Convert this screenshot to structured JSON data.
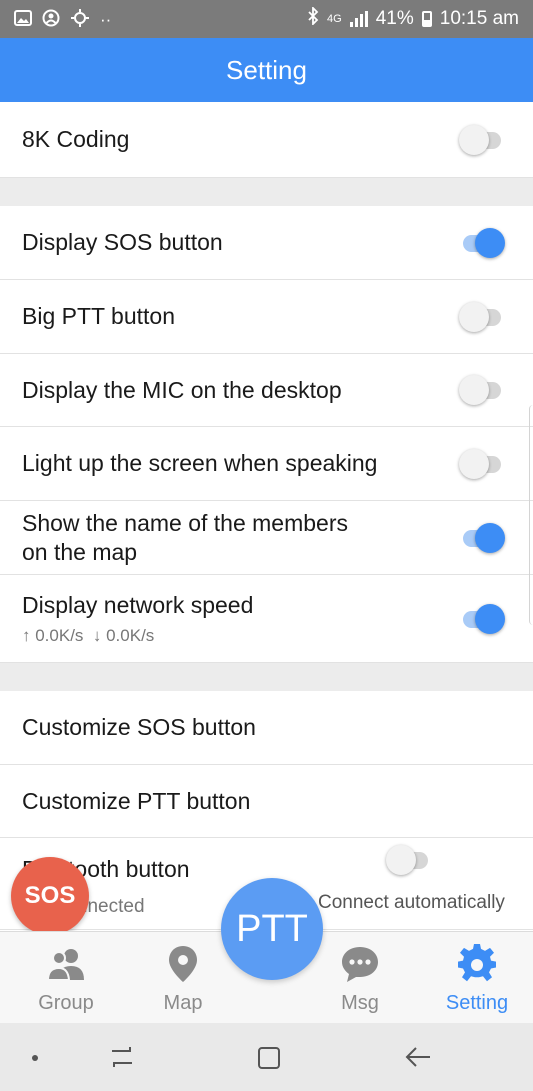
{
  "status_bar": {
    "left_icons": [
      "gallery-icon",
      "account-icon",
      "sync-icon",
      "more-notifications-icon"
    ],
    "bluetooth_icon": "bluetooth-icon",
    "network": "4G",
    "battery": "41%",
    "time": "10:15 am"
  },
  "header": {
    "title": "Setting"
  },
  "settings": {
    "coding_8k": {
      "label": "8K Coding",
      "on": false
    },
    "display_sos": {
      "label": "Display SOS button",
      "on": true
    },
    "big_ptt": {
      "label": "Big PTT button",
      "on": false
    },
    "display_mic": {
      "label": "Display the MIC on the desktop",
      "on": false
    },
    "light_screen": {
      "label": "Light up the screen when speaking",
      "on": false
    },
    "show_names_line1": "Show the name of the members",
    "show_names_line2": "on the map",
    "show_names_on": true,
    "network_speed": {
      "label": "Display network speed",
      "up": "↑ 0.0K/s",
      "down": "↓ 0.0K/s",
      "on": true
    },
    "customize_sos": {
      "label": "Customize SOS button"
    },
    "customize_ptt": {
      "label": "Customize PTT button"
    },
    "bluetooth": {
      "label": "Bluetooth button",
      "status": "Not connected",
      "auto_label": "Connect automatically",
      "on": false
    }
  },
  "sos_fab": {
    "label": "SOS"
  },
  "ptt_fab": {
    "label": "PTT"
  },
  "tabs": {
    "group": "Group",
    "map": "Map",
    "msg": "Msg",
    "setting": "Setting",
    "active": "setting"
  },
  "colors": {
    "accent": "#3d8df5",
    "sos": "#e8624c",
    "ptt": "#5b9cf3"
  }
}
